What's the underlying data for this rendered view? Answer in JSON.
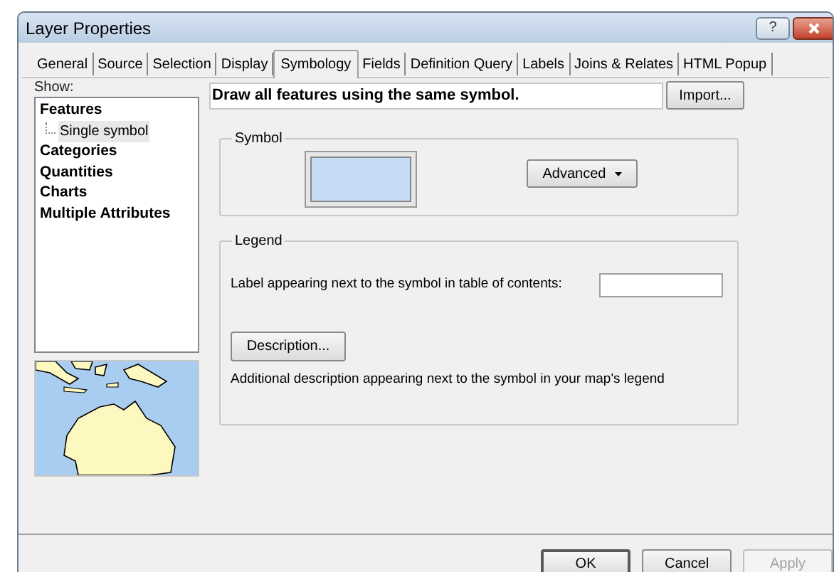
{
  "window": {
    "title": "Layer Properties",
    "help": "?"
  },
  "tabs": [
    {
      "label": "General",
      "selected": false
    },
    {
      "label": "Source",
      "selected": false
    },
    {
      "label": "Selection",
      "selected": false
    },
    {
      "label": "Display",
      "selected": false
    },
    {
      "label": "Symbology",
      "selected": true
    },
    {
      "label": "Fields",
      "selected": false
    },
    {
      "label": "Definition Query",
      "selected": false
    },
    {
      "label": "Labels",
      "selected": false
    },
    {
      "label": "Joins & Relates",
      "selected": false
    },
    {
      "label": "HTML Popup",
      "selected": false
    }
  ],
  "show": {
    "label": "Show:",
    "items": [
      {
        "label": "Features",
        "selected": false,
        "children": [
          {
            "label": "Single symbol",
            "selected": true
          }
        ]
      },
      {
        "label": "Categories",
        "selected": false
      },
      {
        "label": "Quantities",
        "selected": false
      },
      {
        "label": "Charts",
        "selected": false
      },
      {
        "label": "Multiple Attributes",
        "selected": false
      }
    ]
  },
  "heading": "Draw all features using the same symbol.",
  "import_button": "Import...",
  "symbol": {
    "title": "Symbol",
    "advanced_button": "Advanced"
  },
  "legend": {
    "title": "Legend",
    "label_prompt": "Label appearing next to the symbol in table of contents:",
    "description_button": "Description...",
    "description_note": "Additional description appearing next to the symbol in your map's legend"
  },
  "buttons": [
    {
      "label": "OK",
      "disabled": false,
      "default": true
    },
    {
      "label": "Cancel",
      "disabled": false,
      "default": false
    },
    {
      "label": "Apply",
      "disabled": true,
      "default": false
    }
  ]
}
